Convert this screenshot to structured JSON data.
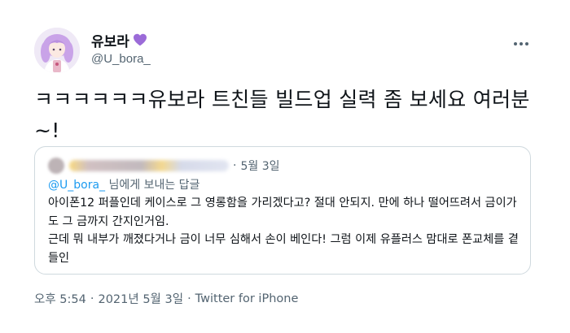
{
  "author": {
    "display_name": "유보라",
    "handle": "@U_bora_",
    "badge_icon": "purple-heart-icon",
    "badge_color": "#9b6bd8"
  },
  "tweet": {
    "text": "ㅋㅋㅋㅋㅋㅋ유보라 트친들 빌드업 실력 좀 보세요 여러분~!"
  },
  "quote": {
    "date": "5월 3일",
    "reply_prefix": "님에게 보내는 답글",
    "reply_mention": "@U_bora_",
    "text": "아이폰12 퍼플인데 케이스로 그 영롱함을 가리겠다고? 절대 안되지. 만에 하나 떨어뜨려서 금이가도 그 금까지 간지인거임.\n근데 뭐 내부가 깨졌다거나 금이 너무 심해서 손이 베인다! 그럼 이제 유플러스 맘대로 폰교체를 곁들인"
  },
  "meta": {
    "time": "오후 5:54",
    "date": "2021년 5월 3일",
    "source": "Twitter for iPhone",
    "separator": "·"
  },
  "colors": {
    "accent": "#1d9bf0",
    "secondary_text": "#536471",
    "border": "#cfd9de"
  }
}
